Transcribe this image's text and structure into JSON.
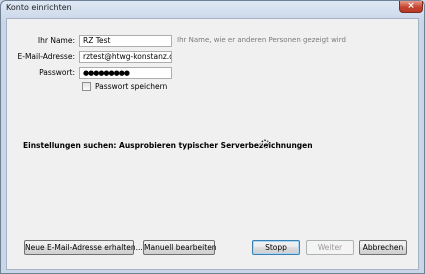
{
  "window": {
    "title": "Konto einrichten",
    "close_glyph": "×"
  },
  "form": {
    "name_label": "Ihr Name:",
    "name_value": "RZ Test",
    "name_hint": "Ihr Name, wie er anderen Personen gezeigt wird",
    "email_label": "E-Mail-Adresse:",
    "email_value": "rztest@htwg-konstanz.de",
    "password_label": "Passwort:",
    "password_value": "●●●●●●●●●",
    "remember_label": "Passwort speichern",
    "remember_checked": false
  },
  "status": {
    "text": "Einstellungen suchen: Ausprobieren typischer Serverbezeichnungen"
  },
  "buttons": {
    "new_address": "Neue E-Mail-Adresse erhalten...",
    "manual": "Manuell bearbeiten",
    "stop": "Stopp",
    "next": "Weiter",
    "cancel": "Abbrechen"
  },
  "colors": {
    "hint": "#7a7a7a",
    "client_bg": "#f0f0f0",
    "frame": "#c9d6e7",
    "close": "#c4452f"
  }
}
